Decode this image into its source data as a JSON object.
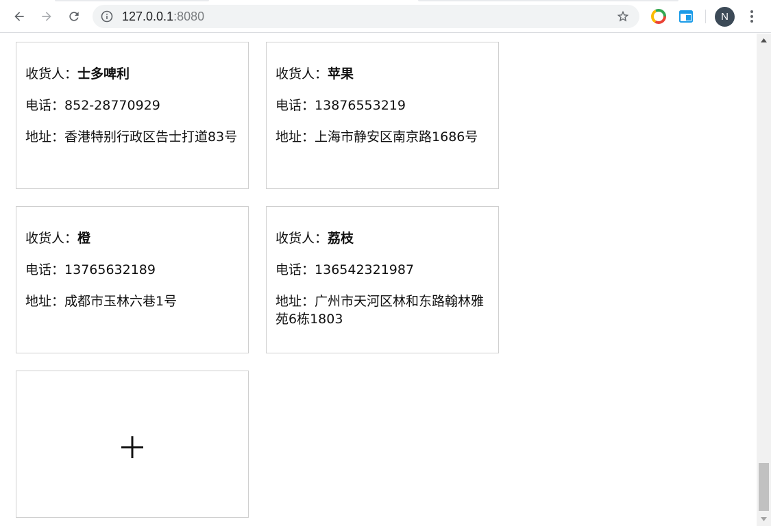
{
  "browser": {
    "url_host": "127.0.0.1",
    "url_port": ":8080",
    "profile_initial": "N",
    "icons": {
      "back": "back-arrow-icon",
      "forward": "forward-arrow-icon",
      "reload": "reload-icon",
      "info": "info-icon",
      "bookmark": "star-icon",
      "extension_1": "chrome-extension-icon",
      "extension_2": "window-extension-icon",
      "menu": "vertical-dots-icon"
    }
  },
  "addresses": [
    {
      "name_label": "收货人：",
      "name": "士多啤利",
      "phone_label": "电话：",
      "phone": "852-28770929",
      "address_label": "地址：",
      "address": "香港特别行政区告士打道83号"
    },
    {
      "name_label": "收货人：",
      "name": "苹果",
      "phone_label": "电话：",
      "phone": "13876553219",
      "address_label": "地址：",
      "address": "上海市静安区南京路1686号"
    },
    {
      "name_label": "收货人：",
      "name": "橙",
      "phone_label": "电话：",
      "phone": "13765632189",
      "address_label": "地址：",
      "address": "成都市玉林六巷1号"
    },
    {
      "name_label": "收货人：",
      "name": "荔枝",
      "phone_label": "电话：",
      "phone": "136542321987",
      "address_label": "地址：",
      "address": "广州市天河区林和东路翰林雅苑6栋1803"
    }
  ],
  "add_card": {
    "icon": "plus-icon"
  },
  "colors": {
    "card_border": "#cfcfcf",
    "text": "#111111",
    "avatar_bg": "#3c4a57",
    "omnibox_bg": "#f1f3f4"
  }
}
